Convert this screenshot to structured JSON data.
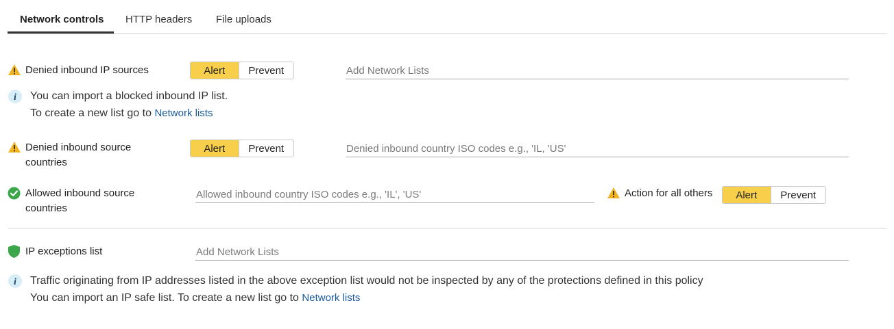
{
  "tabs": [
    {
      "label": "Network controls",
      "active": true
    },
    {
      "label": "HTTP headers",
      "active": false
    },
    {
      "label": "File uploads",
      "active": false
    }
  ],
  "colors": {
    "accent": "#f7cf4a",
    "link": "#1a5aa0",
    "warning": "#f0b323",
    "success": "#3ca64b",
    "info": "#d7eef7"
  },
  "denied_ip": {
    "label": "Denied inbound IP sources",
    "mode_options": [
      "Alert",
      "Prevent"
    ],
    "selected": "Alert",
    "placeholder": "Add Network Lists",
    "info_line1": "You can import a blocked inbound IP list.",
    "info_line2": "To create a new list go to",
    "link": "Network lists"
  },
  "denied_countries": {
    "label_line1": "Denied inbound source",
    "label_line2": "countries",
    "mode_options": [
      "Alert",
      "Prevent"
    ],
    "selected": "Alert",
    "placeholder": "Denied inbound country ISO codes e.g., 'IL, 'US'"
  },
  "allowed_countries": {
    "label_line1": "Allowed inbound source",
    "label_line2": "countries",
    "placeholder": "Allowed inbound country ISO codes e.g., 'IL', 'US'",
    "others_label": "Action for all others",
    "mode_options": [
      "Alert",
      "Prevent"
    ],
    "selected": "Alert"
  },
  "ip_exceptions": {
    "label": "IP exceptions list",
    "placeholder": "Add Network Lists",
    "info_line1": "Traffic originating from IP addresses listed in the above exception list would not be inspected by any of the protections defined in this policy",
    "info_line2": "You can import an IP safe list. To create a new list go to",
    "link": "Network lists"
  }
}
